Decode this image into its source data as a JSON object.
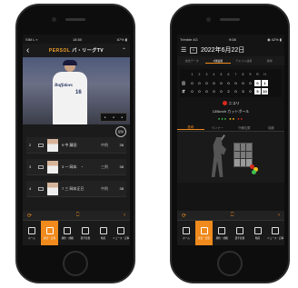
{
  "left_phone": {
    "status": {
      "carrier": "SIM L ▿",
      "time": "18:50",
      "battery": "87% ▮"
    },
    "app_logo_prefix": "PERSOL",
    "app_logo_main": "パ・リーグTV",
    "video": {
      "jersey": "Buffaloes",
      "number": "16"
    },
    "replay_badge": "配球",
    "plays": [
      {
        "pos": "2",
        "name": "9 中 藤田",
        "stat1": "中飛",
        "stat2": "38"
      },
      {
        "pos": "3",
        "name": "3 一 岡本　・",
        "stat1": "三飛",
        "stat2": "38"
      },
      {
        "pos": "4",
        "name": "7 三 岡本正巳",
        "stat1": "中飛",
        "stat2": "38"
      }
    ],
    "subnav": {
      "left": "⟳",
      "center": "⎕",
      "right": "›"
    },
    "tabs": [
      {
        "label": "ホーム",
        "active": false
      },
      {
        "label": "試合・日程",
        "active": true
      },
      {
        "label": "順位・成績",
        "active": false
      },
      {
        "label": "選手名鑑",
        "active": false
      },
      {
        "label": "動画",
        "active": false
      },
      {
        "label": "ニュース・記事",
        "active": false
      }
    ]
  },
  "right_phone": {
    "status": {
      "carrier": "Trimble 4G",
      "time": "9:08",
      "battery": "◉ 42% ▮"
    },
    "date": "2022年6月22日",
    "calendar_label": "31",
    "top_tabs": [
      {
        "label": "試合データ",
        "on": false
      },
      {
        "label": "1球速報",
        "on": true
      },
      {
        "label": "テキスト速報",
        "on": false
      },
      {
        "label": "戦術",
        "on": false
      }
    ],
    "scoreboard": {
      "innings": [
        "1",
        "2",
        "3",
        "4",
        "5",
        "6",
        "7",
        "8",
        "9",
        "R",
        "H"
      ],
      "teams": [
        {
          "abbr": "日",
          "cells": [
            "0",
            "0",
            "0",
            "0",
            "0",
            "0",
            "0",
            "0",
            "0",
            "0",
            "1"
          ]
        },
        {
          "abbr": "オ",
          "cells": [
            "0",
            "0",
            "0",
            "0",
            "0",
            "2",
            "0",
            "3",
            "0",
            "5",
            "10"
          ]
        }
      ]
    },
    "pitch": {
      "title": "ニコリ",
      "speed": "135km/h カットボール",
      "lamps": [
        {
          "cls": "g",
          "glyph": "●●●"
        },
        {
          "cls": "y",
          "glyph": "●●"
        },
        {
          "cls": "r",
          "glyph": "●●"
        }
      ]
    },
    "sub_tabs": [
      {
        "label": "投球",
        "on": true
      },
      {
        "label": "ランナー",
        "on": false
      },
      {
        "label": "守備位置",
        "on": false
      },
      {
        "label": "成績",
        "on": false
      }
    ],
    "subnav": {
      "left": "⟳",
      "center": "⎕",
      "right": "›"
    },
    "tabs": [
      {
        "label": "ホーム",
        "active": false
      },
      {
        "label": "試合・日程",
        "active": true
      },
      {
        "label": "順位・成績",
        "active": false
      },
      {
        "label": "選手名鑑",
        "active": false
      },
      {
        "label": "動画",
        "active": false
      },
      {
        "label": "ニュース・記事",
        "active": false
      }
    ]
  },
  "colors": {
    "accent": "#f08a1c",
    "red": "#d62a1f",
    "yellow": "#f3c21c",
    "green": "#3fbf4f"
  }
}
